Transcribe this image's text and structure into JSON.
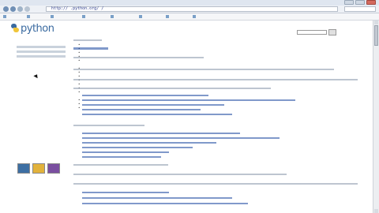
{
  "browser": {
    "address": "http://  .python.org/   /",
    "bookmarks": [
      "",
      "",
      "",
      "",
      "",
      "",
      "",
      ""
    ]
  },
  "site": {
    "logo_text": "python",
    "search_placeholder": "",
    "search_button": "",
    "top_links": [
      "",
      "",
      ""
    ]
  },
  "sidebar": {
    "boxes": [
      {
        "title": "",
        "items": [
          "",
          "",
          "",
          ""
        ]
      },
      {
        "title": "",
        "items": [
          "",
          "",
          "",
          "",
          "",
          ""
        ]
      },
      {
        "title": "",
        "items": [
          "",
          ""
        ]
      }
    ]
  },
  "main": {
    "breadcrumb": "",
    "title": "",
    "paragraphs": [
      "",
      "",
      "",
      "",
      ""
    ],
    "code_block_1": [
      "",
      "",
      "",
      "",
      ""
    ],
    "code_block_2": [
      "",
      "",
      "",
      "",
      "",
      "",
      ""
    ],
    "code_block_3": [
      "",
      "",
      ""
    ]
  },
  "colors": {
    "link": "#1a46a0",
    "logo": "#3a6aa0",
    "logo_accent": "#f0c53a"
  },
  "icons": [
    "python-logo-icon",
    "back-icon",
    "forward-icon",
    "reload-icon",
    "search-icon",
    "cursor-icon"
  ]
}
